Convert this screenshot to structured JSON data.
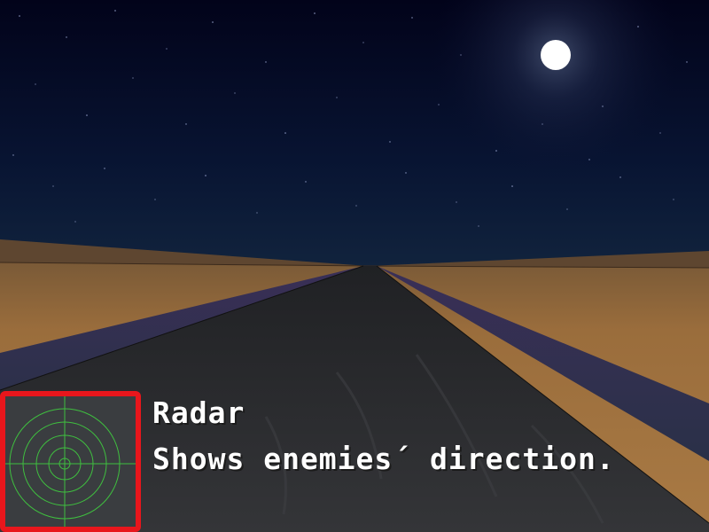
{
  "hud": {
    "item_name": "Radar",
    "item_description": "Shows enemies´ direction."
  },
  "icons": {
    "radar": "radar-icon",
    "moon": "moon-icon"
  },
  "colors": {
    "sky_top": "#02041a",
    "sky_horizon": "#0f2038",
    "moon": "#ffffff",
    "sand": "#a8763f",
    "sand_far": "#5f4731",
    "road": "#2f3134",
    "road_shoulder": "#2a2a4a",
    "highlight_border": "#e8161c",
    "radar_background": "#3a3d40",
    "radar_lines": "#3fbf3f",
    "caption_text": "#ffffff"
  }
}
